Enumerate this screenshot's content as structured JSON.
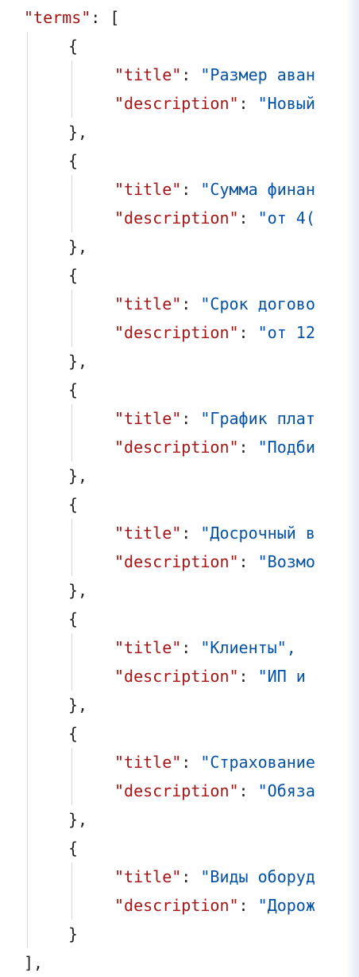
{
  "code": {
    "root_key": "\"terms\"",
    "open_array": "[",
    "close_array": "],",
    "open_brace": "{",
    "close_brace_comma": "},",
    "close_brace": "}",
    "colon": ":",
    "colon_space": ": ",
    "title_key": "\"title\"",
    "description_key": "\"description\"",
    "colors": {
      "key": "#a31515",
      "string": "#0451a5",
      "punctuation": "#1f1f1f"
    },
    "items": [
      {
        "title": "\"Размер аван",
        "description": "\"Новый"
      },
      {
        "title": "\"Сумма финан",
        "description": "\"от 4("
      },
      {
        "title": "\"Срок догово",
        "description": "\"от 12"
      },
      {
        "title": "\"График плат",
        "description": "\"Подби"
      },
      {
        "title": "\"Досрочный в",
        "description": "\"Возмо"
      },
      {
        "title": "\"Клиенты\",",
        "description": "\"ИП и"
      },
      {
        "title": "\"Страхование",
        "description": "\"Обяза"
      },
      {
        "title": "\"Виды оборуд",
        "description": "\"Дорож"
      }
    ]
  }
}
